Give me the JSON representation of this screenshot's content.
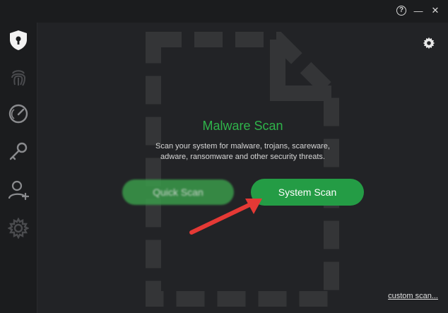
{
  "titlebar": {
    "help_label": "?",
    "minimize_label": "—",
    "close_label": "✕"
  },
  "sidebar": {
    "items": [
      {
        "name": "shield-icon",
        "label": "Protection"
      },
      {
        "name": "fingerprint-icon",
        "label": "Privacy"
      },
      {
        "name": "speedometer-icon",
        "label": "Performance"
      },
      {
        "name": "key-icon",
        "label": "Tools"
      },
      {
        "name": "user-add-icon",
        "label": "Account"
      },
      {
        "name": "settings-icon",
        "label": "Settings"
      }
    ]
  },
  "main": {
    "title": "Malware Scan",
    "description_line1": "Scan your system for malware, trojans, scareware,",
    "description_line2": "adware, ransomware and other security threats.",
    "quick_scan_label": "Quick Scan",
    "system_scan_label": "System Scan",
    "custom_scan_label": "custom scan..."
  },
  "colors": {
    "accent": "#2fb34a",
    "button": "#249c45",
    "background": "#222326",
    "arrow": "#e53935"
  }
}
